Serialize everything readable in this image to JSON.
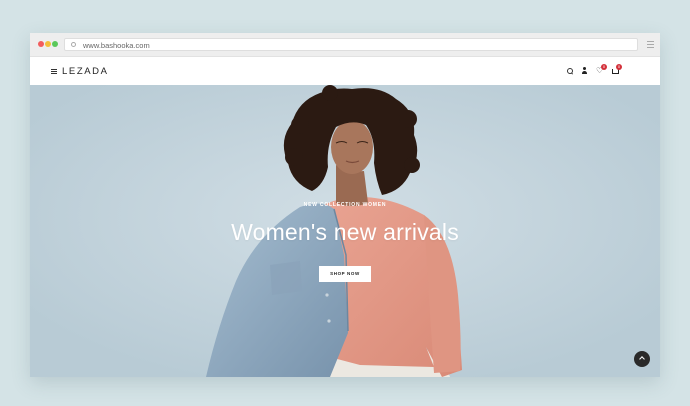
{
  "browser": {
    "url": "www.bashooka.com"
  },
  "site": {
    "logo": "LEZADA",
    "icons": [
      "search-icon",
      "user-icon",
      "heart-icon",
      "cart-icon"
    ],
    "wishlist_count": "0",
    "cart_count": "0"
  },
  "hero": {
    "eyebrow": "NEW COLLECTION WOMEN",
    "headline": "Women's new arrivals",
    "cta_label": "SHOP NOW"
  },
  "colors": {
    "background": "#d4e3e6",
    "hero_bg": "#c5d5de",
    "badge": "#d3303a",
    "sweater": "#e39a88",
    "denim": "#8fa9c0"
  }
}
